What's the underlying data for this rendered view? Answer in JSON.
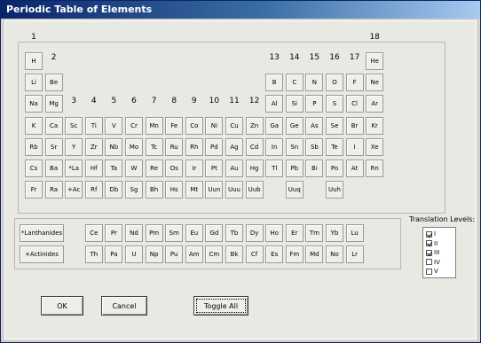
{
  "window": {
    "title": "Periodic Table of Elements"
  },
  "group_labels": [
    "1",
    "2",
    "3",
    "4",
    "5",
    "6",
    "7",
    "8",
    "9",
    "10",
    "11",
    "12",
    "13",
    "14",
    "15",
    "16",
    "17",
    "18"
  ],
  "periods": [
    [
      "H",
      "",
      "",
      "",
      "",
      "",
      "",
      "",
      "",
      "",
      "",
      "",
      "",
      "",
      "",
      "",
      "",
      "He"
    ],
    [
      "Li",
      "Be",
      "",
      "",
      "",
      "",
      "",
      "",
      "",
      "",
      "",
      "",
      "B",
      "C",
      "N",
      "O",
      "F",
      "Ne"
    ],
    [
      "Na",
      "Mg",
      "",
      "",
      "",
      "",
      "",
      "",
      "",
      "",
      "",
      "",
      "Al",
      "Si",
      "P",
      "S",
      "Cl",
      "Ar"
    ],
    [
      "K",
      "Ca",
      "Sc",
      "Ti",
      "V",
      "Cr",
      "Mn",
      "Fe",
      "Co",
      "Ni",
      "Cu",
      "Zn",
      "Ga",
      "Ge",
      "As",
      "Se",
      "Br",
      "Kr"
    ],
    [
      "Rb",
      "Sr",
      "Y",
      "Zr",
      "Nb",
      "Mo",
      "Tc",
      "Ru",
      "Rh",
      "Pd",
      "Ag",
      "Cd",
      "In",
      "Sn",
      "Sb",
      "Te",
      "I",
      "Xe"
    ],
    [
      "Cs",
      "Ba",
      "*La",
      "Hf",
      "Ta",
      "W",
      "Re",
      "Os",
      "Ir",
      "Pt",
      "Au",
      "Hg",
      "Tl",
      "Pb",
      "Bi",
      "Po",
      "At",
      "Rn"
    ],
    [
      "Fr",
      "Ra",
      "+Ac",
      "Rf",
      "Db",
      "Sg",
      "Bh",
      "Hs",
      "Mt",
      "Uun",
      "Uuu",
      "Uub",
      "",
      "Uuq",
      "",
      "Uuh",
      "",
      ""
    ]
  ],
  "series": [
    {
      "label": "*Lanthanides",
      "elements": [
        "Ce",
        "Pr",
        "Nd",
        "Pm",
        "Sm",
        "Eu",
        "Gd",
        "Tb",
        "Dy",
        "Ho",
        "Er",
        "Tm",
        "Yb",
        "Lu"
      ]
    },
    {
      "label": "+Actinides",
      "elements": [
        "Th",
        "Pa",
        "U",
        "Np",
        "Pu",
        "Am",
        "Cm",
        "Bk",
        "Cf",
        "Es",
        "Fm",
        "Md",
        "No",
        "Lr"
      ]
    }
  ],
  "translation": {
    "label": "Translation Levels:",
    "levels": [
      {
        "label": "I",
        "checked": true
      },
      {
        "label": "II",
        "checked": true
      },
      {
        "label": "III",
        "checked": true
      },
      {
        "label": "IV",
        "checked": false
      },
      {
        "label": "V",
        "checked": false
      }
    ]
  },
  "buttons": {
    "ok": "OK",
    "cancel": "Cancel",
    "toggle_all": "Toggle All"
  },
  "colors": {
    "title_bar": "#0a246a",
    "dialog_bg": "#d6d3ce",
    "cell_bg": "#efeeea"
  }
}
